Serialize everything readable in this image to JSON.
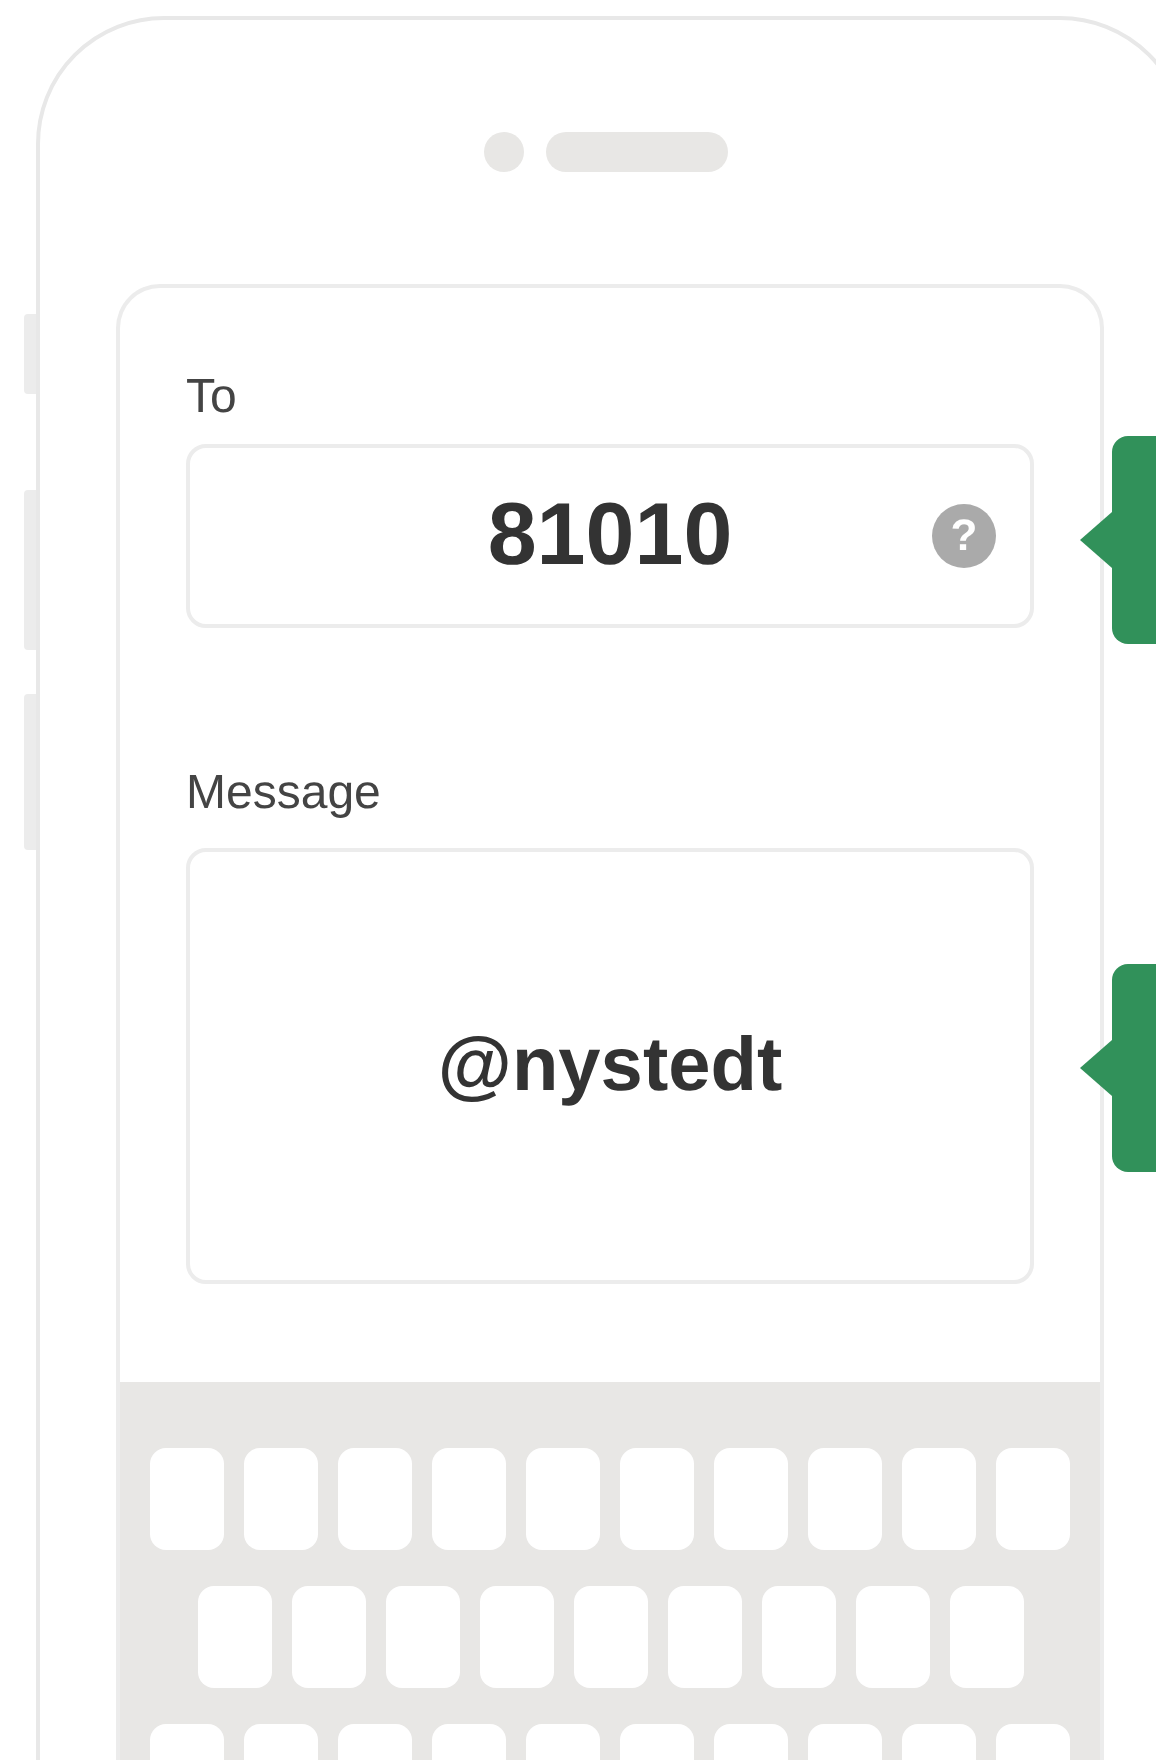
{
  "to_field": {
    "label": "To",
    "value": "81010",
    "help": "?"
  },
  "message_field": {
    "label": "Message",
    "value": "@nystedt"
  }
}
